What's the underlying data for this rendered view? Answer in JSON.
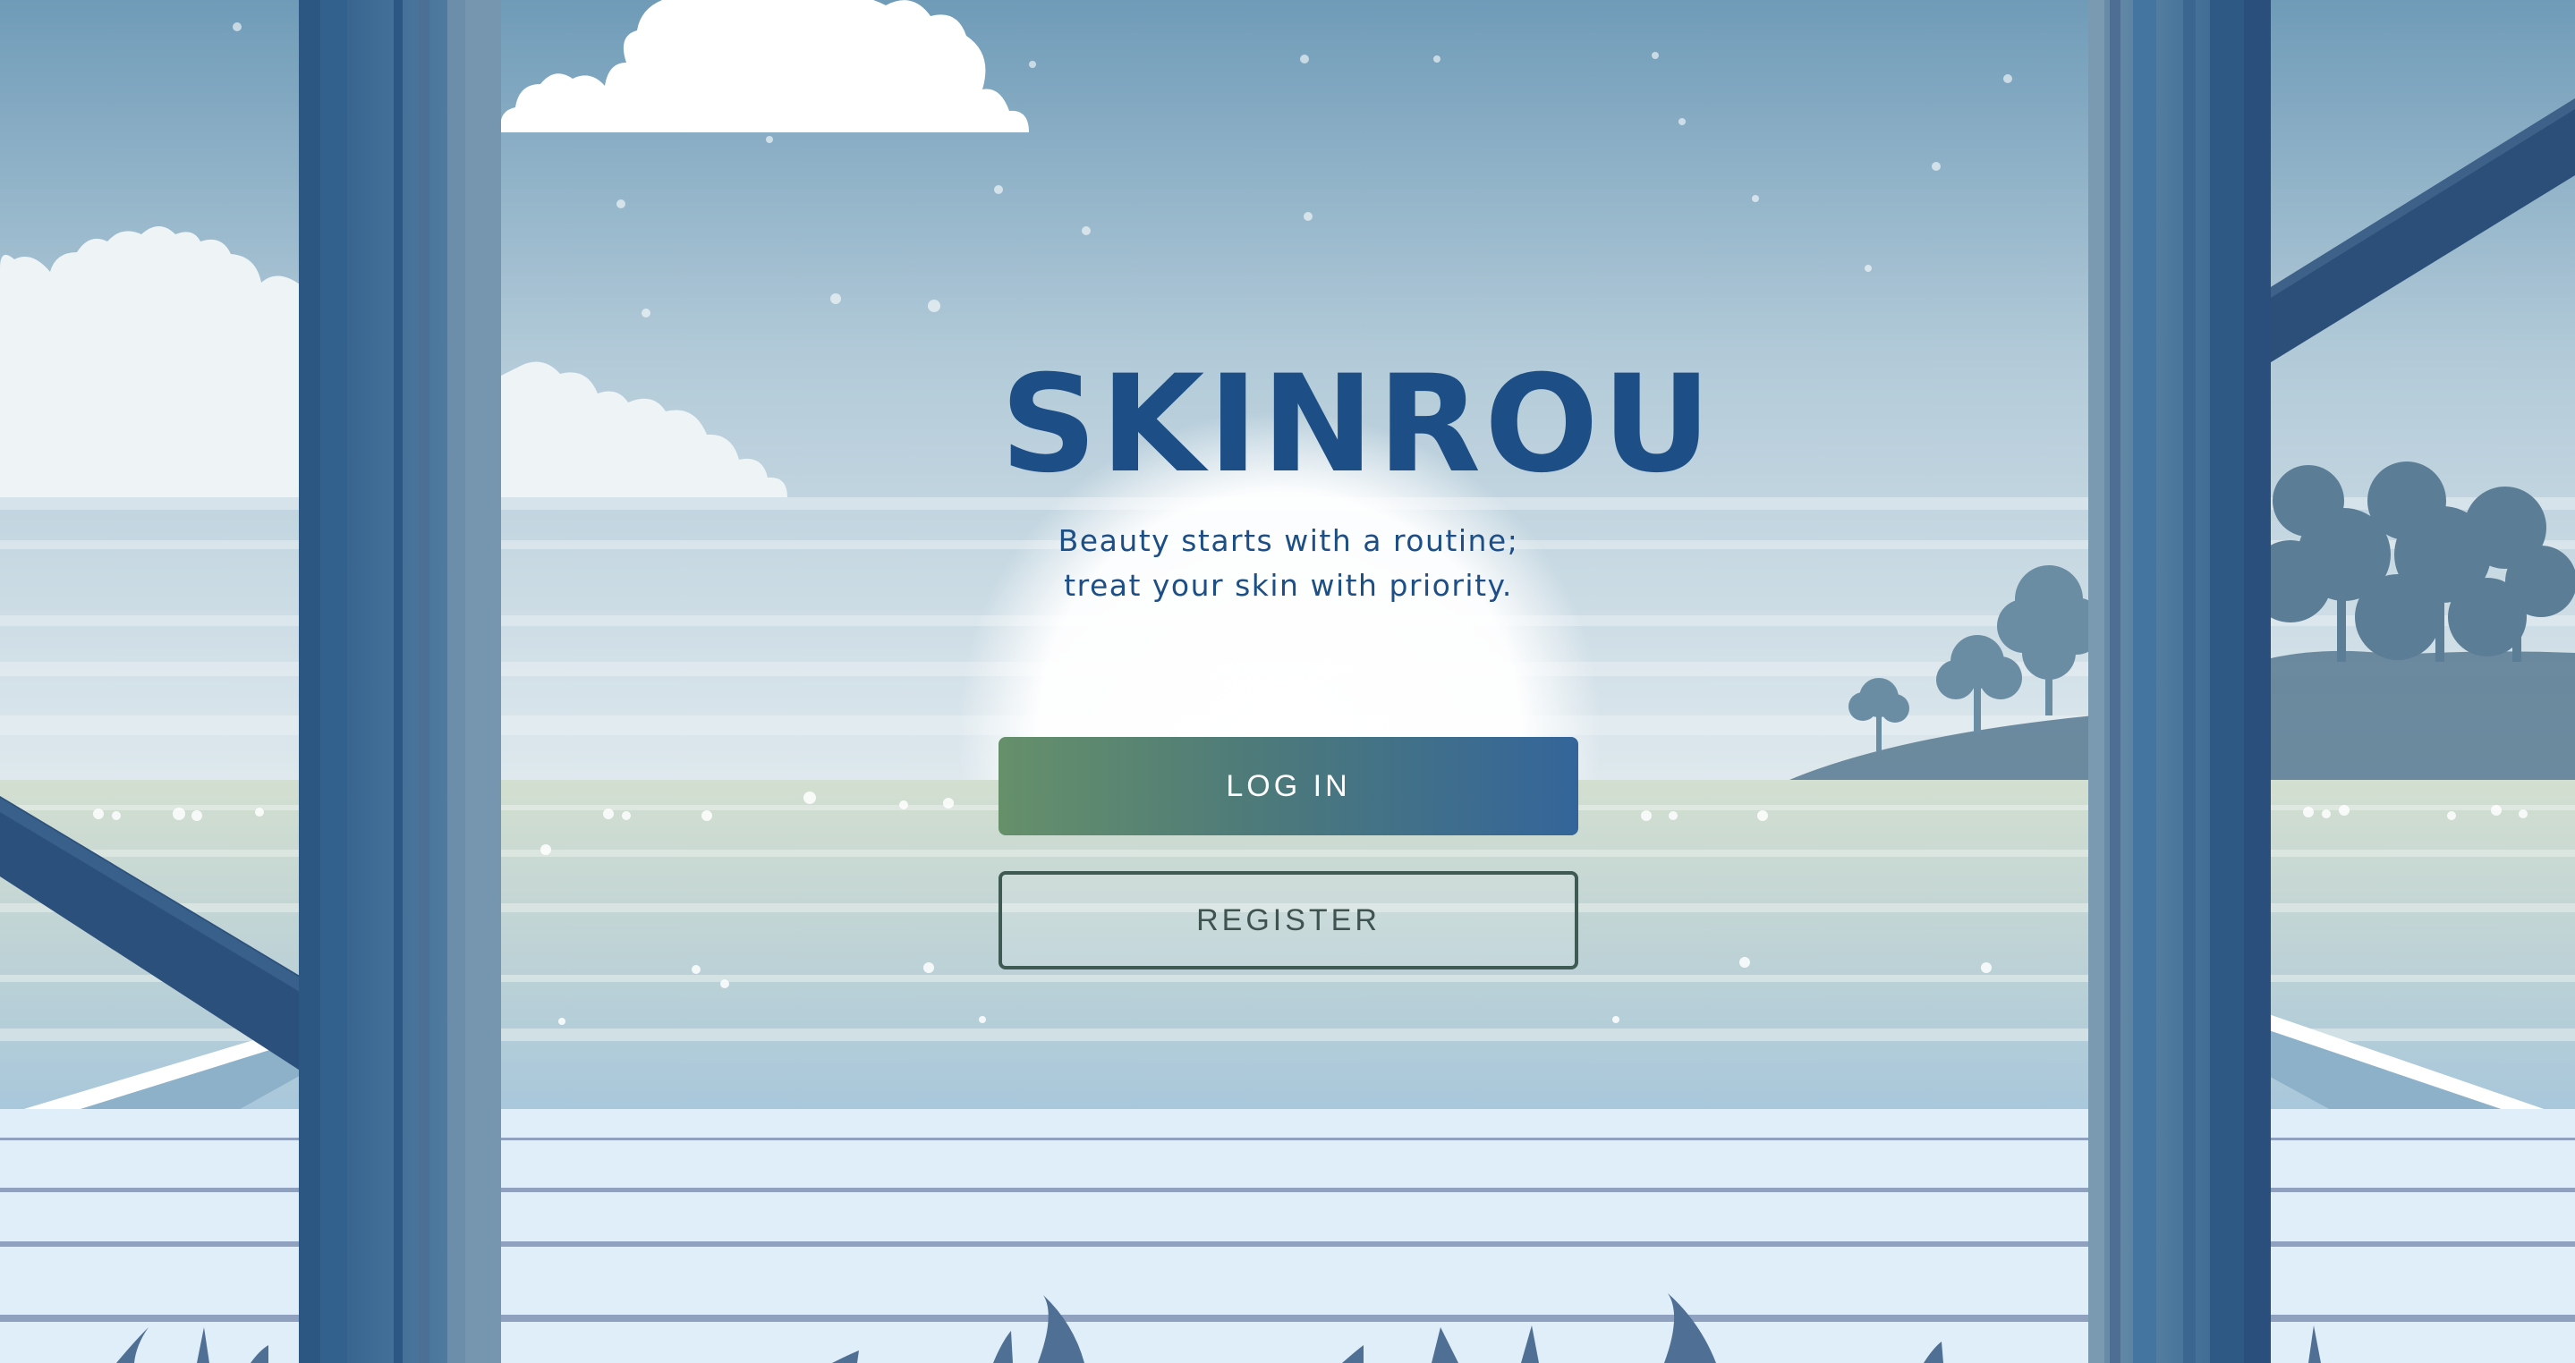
{
  "brand": {
    "logo_text": "SKINROU",
    "tagline_line1": "Beauty starts with a routine;",
    "tagline_line2": "treat your skin with priority."
  },
  "actions": {
    "login_label": "LOG IN",
    "register_label": "REGISTER"
  },
  "colors": {
    "brand_blue": "#1d4f86",
    "login_gradient_start": "#66906a",
    "login_gradient_end": "#34659a",
    "register_border": "#3f5a52",
    "sky_top": "#6e9ab7",
    "water": "#b7cfdc",
    "deck": "#e0eefa",
    "pillar": "#3c6a94"
  }
}
